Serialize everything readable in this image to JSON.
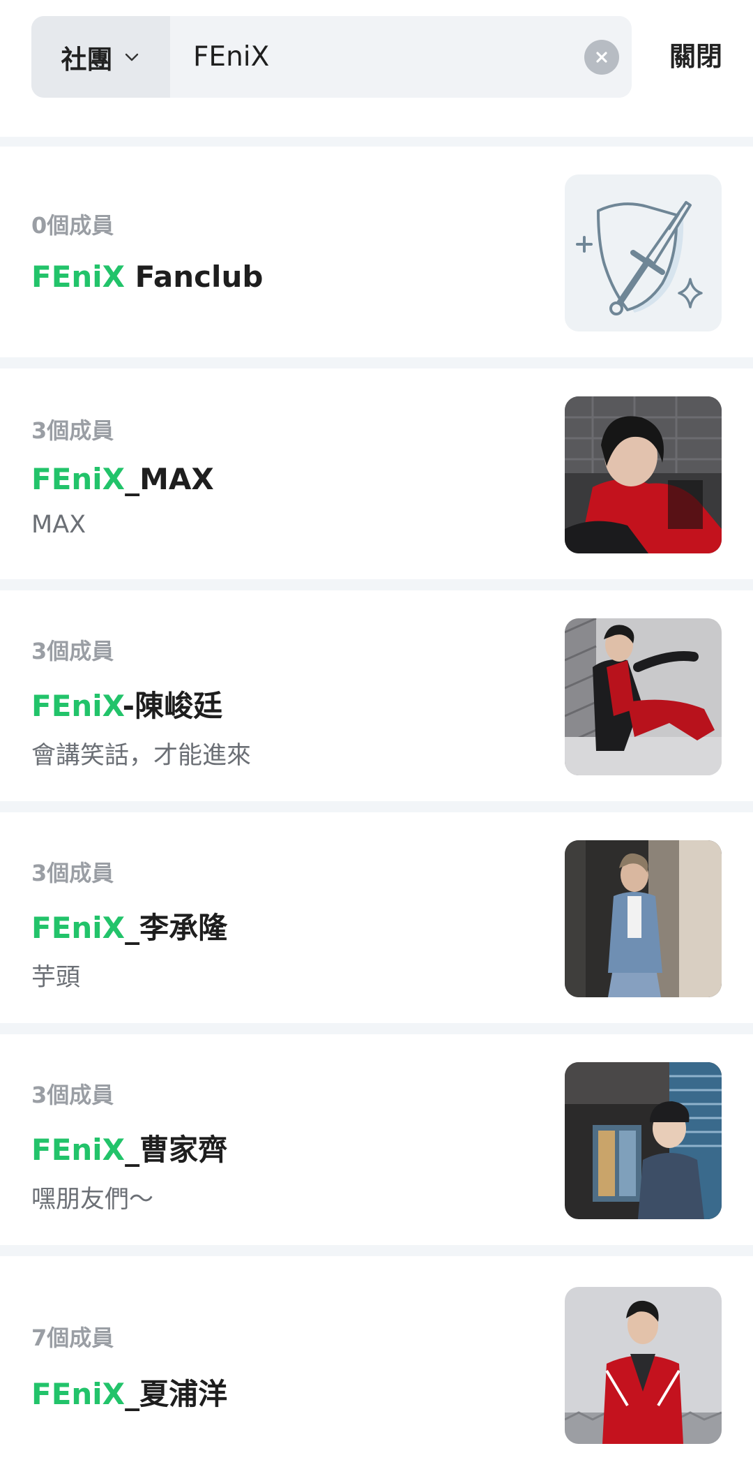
{
  "search": {
    "category_label": "社團",
    "query": "FEniX",
    "close_label": "關閉"
  },
  "results": [
    {
      "members": "0個成員",
      "name_highlight": "FEniX",
      "name_rest": " Fanclub",
      "description": "",
      "thumbnail": "shield-sword-icon"
    },
    {
      "members": "3個成員",
      "name_highlight": "FEniX",
      "name_rest": "_MAX",
      "description": "MAX",
      "thumbnail": "member-photo"
    },
    {
      "members": "3個成員",
      "name_highlight": "FEniX",
      "name_rest": "-陳峻廷",
      "description": "會講笑話，才能進來",
      "thumbnail": "member-photo"
    },
    {
      "members": "3個成員",
      "name_highlight": "FEniX",
      "name_rest": "_李承隆",
      "description": "芋頭",
      "thumbnail": "member-photo"
    },
    {
      "members": "3個成員",
      "name_highlight": "FEniX",
      "name_rest": "_曹家齊",
      "description": "嘿朋友們～",
      "thumbnail": "member-photo"
    },
    {
      "members": "7個成員",
      "name_highlight": "FEniX",
      "name_rest": "_夏浦洋",
      "description": "",
      "thumbnail": "member-photo"
    }
  ],
  "colors": {
    "highlight": "#22c36a",
    "separator": "#f2f5f8"
  }
}
